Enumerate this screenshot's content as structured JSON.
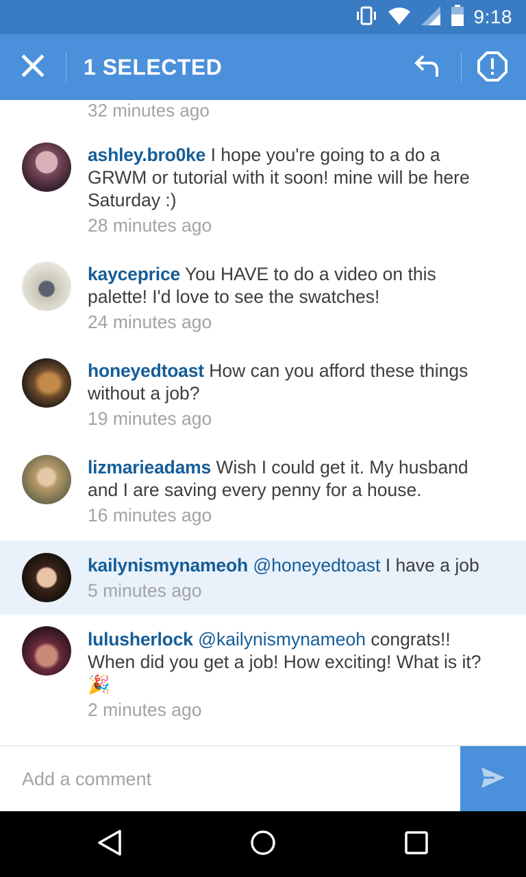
{
  "status_bar": {
    "time": "9:18"
  },
  "app_bar": {
    "title": "1 SELECTED"
  },
  "previous_timestamp": "32 minutes ago",
  "comments": [
    {
      "username": "ashley.bro0ke",
      "text": "I hope you're going to a do a GRWM or tutorial with it soon! mine will be here Saturday :)",
      "time": "28 minutes ago"
    },
    {
      "username": "kayceprice",
      "text": "You HAVE to do a video on this palette! I'd love to see the swatches!",
      "time": "24 minutes ago"
    },
    {
      "username": "honeyedtoast",
      "text": "How can you afford these things without a job?",
      "time": "19 minutes ago"
    },
    {
      "username": "lizmarieadams",
      "text": "Wish I could get it. My husband and I are saving every penny for a house.",
      "time": "16 minutes ago"
    },
    {
      "username": "kailynismynameoh",
      "mention": "@honeyedtoast",
      "text": "I have a job",
      "time": "5 minutes ago",
      "selected": true
    },
    {
      "username": "lulusherlock",
      "mention": "@kailynismynameoh",
      "text": "congrats!! When did you get a job! How exciting! What is it? 🎉",
      "time": "2 minutes ago"
    }
  ],
  "comment_bar": {
    "placeholder": "Add a comment"
  },
  "colors": {
    "status_bar": "#3a7cc3",
    "app_bar": "#4b90da",
    "username": "#155d98",
    "timestamp": "#a3a3a3",
    "selected_row": "#e9f1fb"
  },
  "icons": {
    "status": [
      "vibrate-icon",
      "wifi-icon",
      "signal-icon",
      "battery-icon"
    ],
    "app_bar": [
      "close-icon",
      "reply-icon",
      "report-icon"
    ],
    "comment_bar": [
      "send-icon"
    ],
    "nav": [
      "back-icon",
      "home-icon",
      "recents-icon"
    ]
  }
}
